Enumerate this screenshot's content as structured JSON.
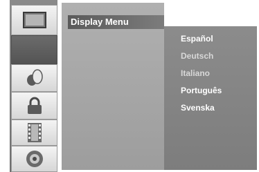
{
  "menu": {
    "title": "Display Menu"
  },
  "sidebar": {
    "items": [
      {
        "icon": "tv-icon",
        "active": false
      },
      {
        "icon": "blank",
        "active": true
      },
      {
        "icon": "audio-icon",
        "active": false
      },
      {
        "icon": "lock-icon",
        "active": false
      },
      {
        "icon": "film-icon",
        "active": false
      },
      {
        "icon": "disc-icon",
        "active": false
      }
    ]
  },
  "languages": {
    "options": [
      "Español",
      "Deutsch",
      "Italiano",
      "Português",
      "Svenska"
    ]
  },
  "colors": {
    "panel": "#a3a3a3",
    "highlight": "#5a5a5a",
    "text": "#ffffff"
  }
}
